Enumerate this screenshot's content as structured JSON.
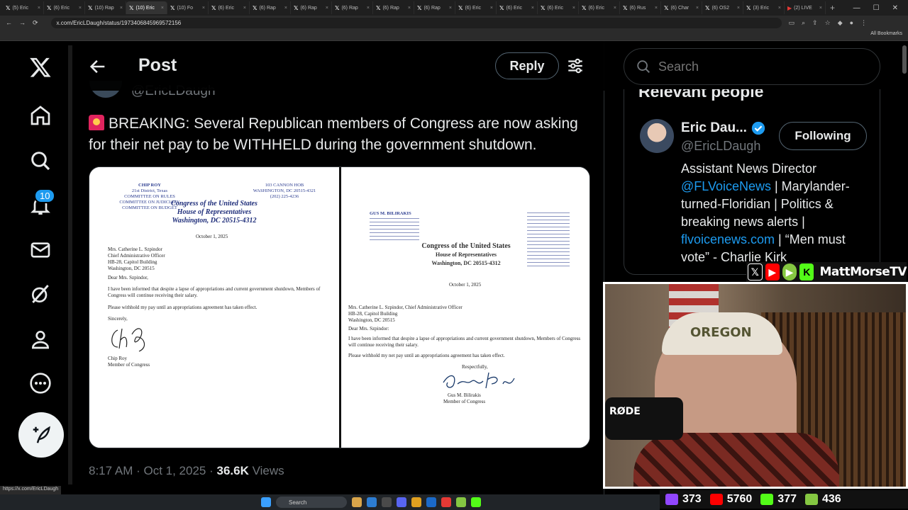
{
  "browser": {
    "tabs": [
      {
        "icon": "x",
        "label": "(5) Eric"
      },
      {
        "icon": "x",
        "label": "(6) Eric"
      },
      {
        "icon": "x",
        "label": "(10) Rap"
      },
      {
        "icon": "x",
        "label": "(10) Eric",
        "active": true
      },
      {
        "icon": "x",
        "label": "(10) Fo"
      },
      {
        "icon": "x",
        "label": "(6) Eric"
      },
      {
        "icon": "x",
        "label": "(6) Rap"
      },
      {
        "icon": "x",
        "label": "(6) Rap"
      },
      {
        "icon": "x",
        "label": "(6) Rap"
      },
      {
        "icon": "x",
        "label": "(6) Rap"
      },
      {
        "icon": "x",
        "label": "(6) Rap"
      },
      {
        "icon": "x",
        "label": "(6) Eric"
      },
      {
        "icon": "x",
        "label": "(6) Eric"
      },
      {
        "icon": "x",
        "label": "(6) Eric"
      },
      {
        "icon": "x",
        "label": "(6) Eric"
      },
      {
        "icon": "x",
        "label": "(6) Rus"
      },
      {
        "icon": "x",
        "label": "(6) Char"
      },
      {
        "icon": "x",
        "label": "(6) OS2"
      },
      {
        "icon": "x",
        "label": "(3) Eric"
      },
      {
        "icon": "yt",
        "label": "(2) LIVE"
      }
    ],
    "url": "x.com/EricLDaugh/status/1973406845969572156",
    "all_bookmarks": "All Bookmarks",
    "status_url": "https://x.com/EricLDaugh"
  },
  "nav": {
    "notification_count": "10"
  },
  "header": {
    "title": "Post",
    "reply_label": "Reply"
  },
  "post": {
    "handle": "@EricLDaugh",
    "text": "BREAKING: Several Republican members of Congress are now asking for their net pay to be WITHHELD during the government shutdown.",
    "time": "8:17 AM · Oct 1, 2025 · ",
    "views_count": "36.6K",
    "views_label": " Views"
  },
  "letter_left": {
    "sender_name": "CHIP ROY",
    "sender_district": "21st District, Texas",
    "committees": [
      "COMMITTEE ON RULES",
      "COMMITTEE ON JUDICIARY",
      "COMMITTEE ON BUDGET"
    ],
    "office": "103 CANNON HOB",
    "office_city": "WASHINGTON, DC 20515-4321",
    "phone": "(202) 225-4236",
    "letterhead_1": "Congress of the United States",
    "letterhead_2": "House of Representatives",
    "letterhead_3": "Washington, DC 20515-4312",
    "date": "October 1, 2025",
    "recipient": [
      "Mrs. Catherine L. Szpindor",
      "Chief Administrative Officer",
      "HB-28, Capitol Building",
      "Washington, DC 20515"
    ],
    "salutation": "Dear Mrs. Szpindor,",
    "body_1": "I have been informed that despite a lapse of appropriations and current government shutdown, Members of Congress will continue receiving their salary.",
    "body_2": "Please withhold my pay until an appropriations agreement has taken effect.",
    "closing": "Sincerely,",
    "signer": "Chip Roy",
    "signer_title": "Member of Congress"
  },
  "letter_right": {
    "sender_name": "GUS M. BILIRAKIS",
    "letterhead_1": "Congress of the United States",
    "letterhead_2": "House of Representatives",
    "letterhead_3": "Washington, DC 20515-4312",
    "date": "October 1, 2025",
    "recipient": [
      "Mrs. Catherine L. Szpindor, Chief Administrative Officer",
      "HB-28, Capitol Building",
      "Washington, DC 20515"
    ],
    "salutation": "Dear Mrs. Szpindor:",
    "body_1": "I have been informed that despite a lapse of appropriations and current government shutdown, Members of Congress will continue receiving their salary.",
    "body_2": "Please withhold my net pay until an appropriations agreement has taken effect.",
    "closing": "Respectfully,",
    "signer": "Gus M. Bilirakis",
    "signer_title": "Member of Congress"
  },
  "search": {
    "placeholder": "Search"
  },
  "relevant": {
    "title": "Relevant people",
    "name": "Eric Dau...",
    "handle": "@EricLDaugh",
    "follow_label": "Following",
    "bio_1": "Assistant News Director ",
    "bio_link_1": "@FLVoiceNews",
    "bio_2": " | Marylander-turned-Floridian | Politics & breaking news alerts | ",
    "bio_link_2": "flvoicenews.com",
    "bio_3": " | “Men must vote” - Charlie Kirk"
  },
  "stream": {
    "brand": "MattMorseTV",
    "cap_text": "OREGON",
    "mic_text": "RØDE",
    "stats": [
      {
        "platform": "twitch",
        "count": "373",
        "color": "#9146ff"
      },
      {
        "platform": "youtube",
        "count": "5760",
        "color": "#ff0000"
      },
      {
        "platform": "kick",
        "count": "377",
        "color": "#53fc18"
      },
      {
        "platform": "rumble",
        "count": "436",
        "color": "#85c742"
      }
    ]
  },
  "taskbar": {
    "search_label": "Search"
  }
}
